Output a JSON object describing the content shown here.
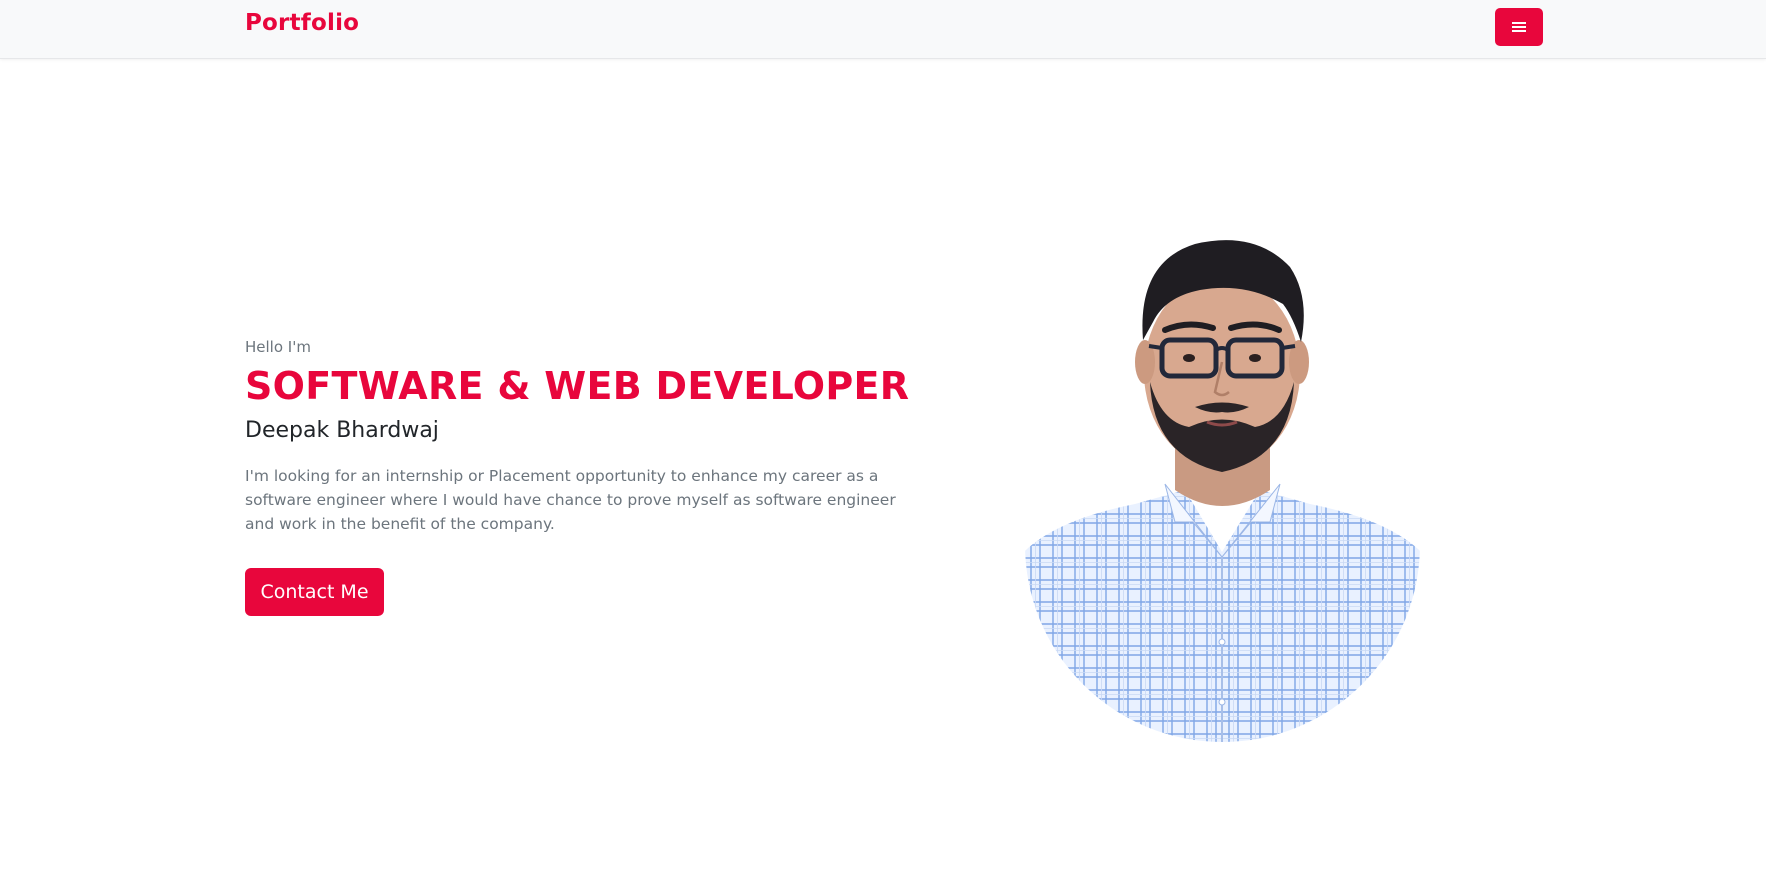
{
  "navbar": {
    "brand": "Portfolio",
    "menu_icon": "hamburger-icon"
  },
  "hero": {
    "greeting": "Hello I'm",
    "headline": "SOFTWARE & WEB DEVELOPER",
    "name": "Deepak Bhardwaj",
    "bio": "I'm looking for an internship or Placement opportunity to enhance my career as a software engineer where I would have chance to prove myself as software engineer and work in the benefit of the company.",
    "cta_label": "Contact Me"
  },
  "colors": {
    "accent": "#e8063c",
    "navbar_bg": "#f8f9fa",
    "text_dark": "#212529",
    "text_muted": "#6c757d"
  }
}
